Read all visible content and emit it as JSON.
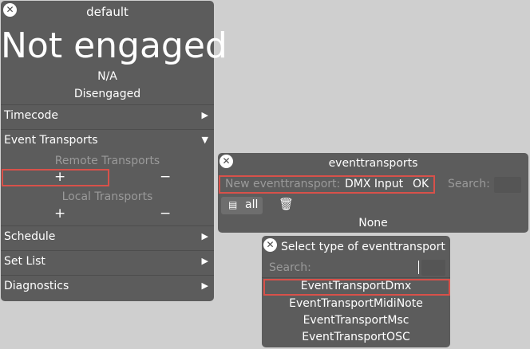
{
  "main_panel": {
    "title": "default",
    "status_big": "Not engaged",
    "status_na": "N/A",
    "status_sub": "Disengaged",
    "sections": [
      {
        "label": "Timecode",
        "arrow": "▶"
      },
      {
        "label": "Event Transports",
        "arrow": "▼"
      },
      {
        "label": "Schedule",
        "arrow": "▶"
      },
      {
        "label": "Set List",
        "arrow": "▶"
      },
      {
        "label": "Diagnostics",
        "arrow": "▶"
      }
    ],
    "remote_transports_label": "Remote Transports",
    "local_transports_label": "Local Transports",
    "plus": "+",
    "minus": "−"
  },
  "eventtransports_panel": {
    "title": "eventtransports",
    "new_label": "New eventtransport:",
    "new_value": "DMX Input",
    "ok_label": "OK",
    "search_label": "Search:",
    "all_label": "all",
    "trash_icon": "🗑",
    "none_label": "None"
  },
  "select_panel": {
    "title": "Select type of eventtransport",
    "search_label": "Search:",
    "options": [
      "EventTransportDmx",
      "EventTransportMidiNote",
      "EventTransportMsc",
      "EventTransportOSC"
    ]
  },
  "colors": {
    "panel": "#5c5c5c",
    "background": "#cfcfcf",
    "highlight": "#d8514a",
    "muted_text": "#9a9a9a"
  }
}
